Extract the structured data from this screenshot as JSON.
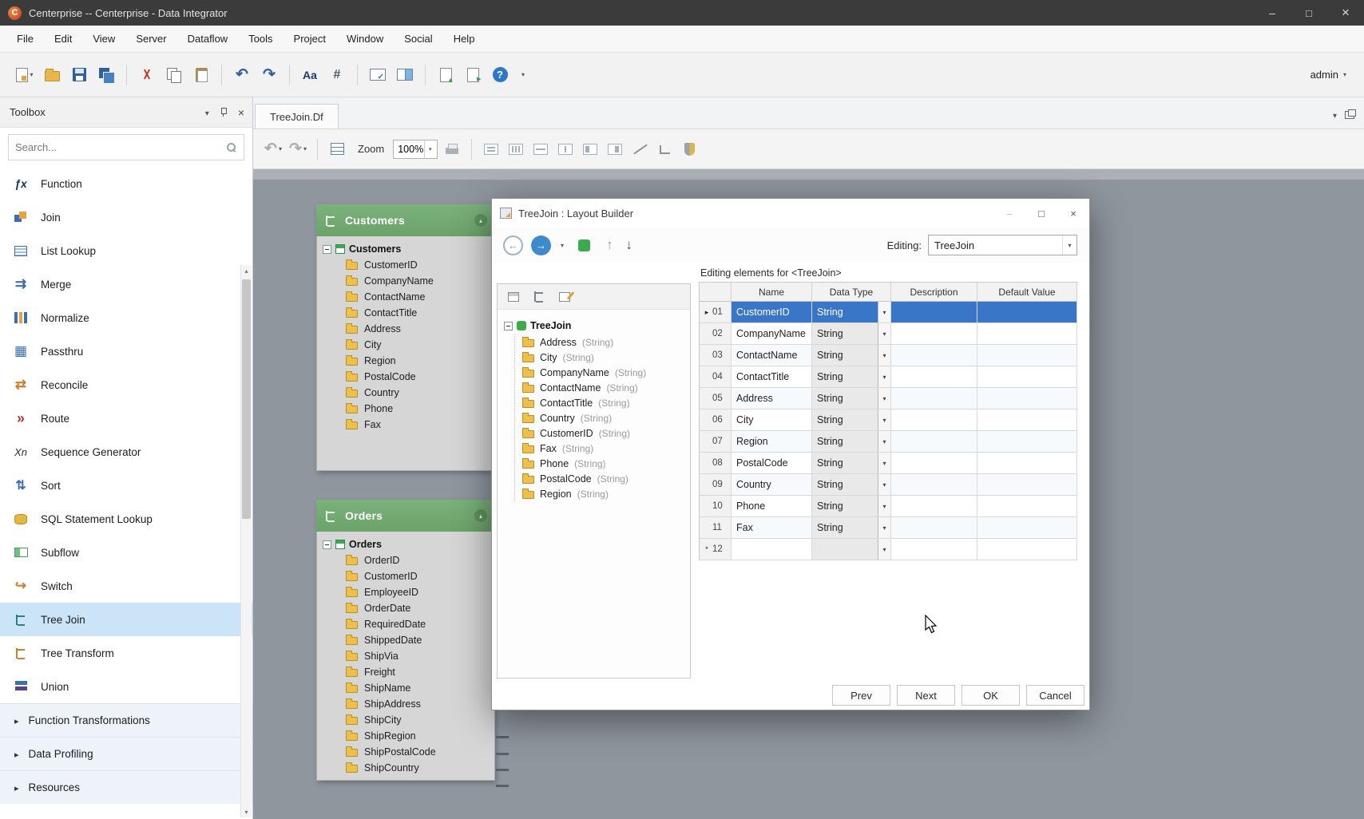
{
  "titlebar": {
    "title": "Centerprise -- Centerprise - Data Integrator"
  },
  "menubar": {
    "items": [
      "File",
      "Edit",
      "View",
      "Server",
      "Dataflow",
      "Tools",
      "Project",
      "Window",
      "Social",
      "Help"
    ]
  },
  "toolbar": {
    "user": "admin"
  },
  "toolbox": {
    "title": "Toolbox",
    "search_placeholder": "Search...",
    "items": [
      "Function",
      "Join",
      "List Lookup",
      "Merge",
      "Normalize",
      "Passthru",
      "Reconcile",
      "Route",
      "Sequence Generator",
      "Sort",
      "SQL Statement Lookup",
      "Subflow",
      "Switch",
      "Tree Join",
      "Tree Transform",
      "Union"
    ],
    "sections": [
      "Function Transformations",
      "Data Profiling",
      "Resources"
    ]
  },
  "tabbar": {
    "active_tab": "TreeJoin.Df"
  },
  "canvas_toolbar": {
    "zoom_label": "Zoom",
    "zoom_value": "100%"
  },
  "canvas": {
    "nodes": [
      {
        "title": "Customers",
        "root": "Customers",
        "fields": [
          "CustomerID",
          "CompanyName",
          "ContactName",
          "ContactTitle",
          "Address",
          "City",
          "Region",
          "PostalCode",
          "Country",
          "Phone",
          "Fax"
        ]
      },
      {
        "title": "Orders",
        "root": "Orders",
        "fields": [
          "OrderID",
          "CustomerID",
          "EmployeeID",
          "OrderDate",
          "RequiredDate",
          "ShippedDate",
          "ShipVia",
          "Freight",
          "ShipName",
          "ShipAddress",
          "ShipCity",
          "ShipRegion",
          "ShipPostalCode",
          "ShipCountry"
        ]
      }
    ]
  },
  "dialog": {
    "title": "TreeJoin : Layout Builder",
    "editing_label": "Editing:",
    "editing_value": "TreeJoin",
    "tree": {
      "root": "TreeJoin",
      "items": [
        {
          "name": "Address",
          "type": "(String)"
        },
        {
          "name": "City",
          "type": "(String)"
        },
        {
          "name": "CompanyName",
          "type": "(String)"
        },
        {
          "name": "ContactName",
          "type": "(String)"
        },
        {
          "name": "ContactTitle",
          "type": "(String)"
        },
        {
          "name": "Country",
          "type": "(String)"
        },
        {
          "name": "CustomerID",
          "type": "(String)"
        },
        {
          "name": "Fax",
          "type": "(String)"
        },
        {
          "name": "Phone",
          "type": "(String)"
        },
        {
          "name": "PostalCode",
          "type": "(String)"
        },
        {
          "name": "Region",
          "type": "(String)"
        }
      ]
    },
    "grid": {
      "caption": "Editing elements for <TreeJoin>",
      "columns": [
        "Name",
        "Data Type",
        "Description",
        "Default Value"
      ],
      "rows": [
        {
          "marker": "▸",
          "num": "01",
          "name": "CustomerID",
          "type": "String"
        },
        {
          "marker": "",
          "num": "02",
          "name": "CompanyName",
          "type": "String"
        },
        {
          "marker": "",
          "num": "03",
          "name": "ContactName",
          "type": "String"
        },
        {
          "marker": "",
          "num": "04",
          "name": "ContactTitle",
          "type": "String"
        },
        {
          "marker": "",
          "num": "05",
          "name": "Address",
          "type": "String"
        },
        {
          "marker": "",
          "num": "06",
          "name": "City",
          "type": "String"
        },
        {
          "marker": "",
          "num": "07",
          "name": "Region",
          "type": "String"
        },
        {
          "marker": "",
          "num": "08",
          "name": "PostalCode",
          "type": "String"
        },
        {
          "marker": "",
          "num": "09",
          "name": "Country",
          "type": "String"
        },
        {
          "marker": "",
          "num": "10",
          "name": "Phone",
          "type": "String"
        },
        {
          "marker": "",
          "num": "11",
          "name": "Fax",
          "type": "String"
        },
        {
          "marker": "*",
          "num": "12",
          "name": "",
          "type": ""
        }
      ]
    },
    "buttons": [
      "Prev",
      "Next",
      "OK",
      "Cancel"
    ]
  }
}
